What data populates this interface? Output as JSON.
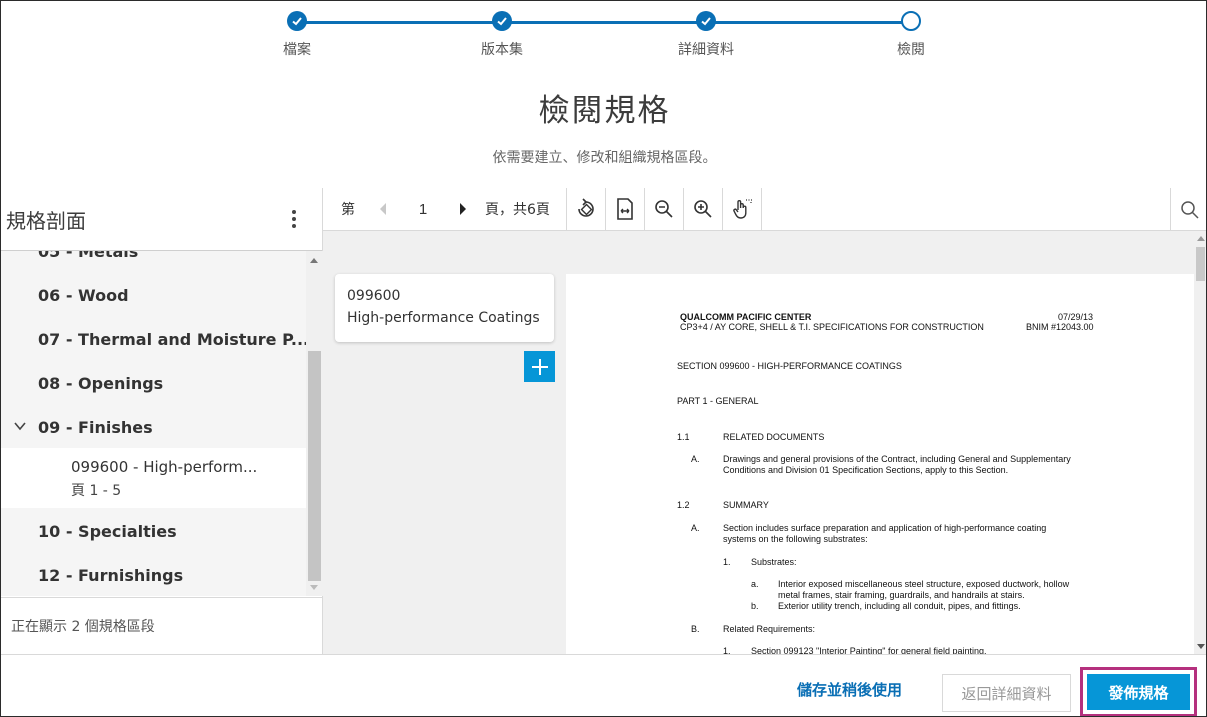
{
  "stepper": {
    "steps": [
      {
        "label": "檔案",
        "state": "done"
      },
      {
        "label": "版本集",
        "state": "done"
      },
      {
        "label": "詳細資料",
        "state": "done"
      },
      {
        "label": "檢閱",
        "state": "current"
      }
    ]
  },
  "page": {
    "title": "檢閱規格",
    "subtitle": "依需要建立、修改和組織規格區段。"
  },
  "sidebar": {
    "title": "規格剖面",
    "items": [
      {
        "label": "05 - Metals",
        "expanded": false
      },
      {
        "label": "06 - Wood",
        "expanded": false
      },
      {
        "label": "07 - Thermal and Moisture P...",
        "expanded": false
      },
      {
        "label": "08 - Openings",
        "expanded": false
      },
      {
        "label": "09 - Finishes",
        "expanded": true
      },
      {
        "label": "10 - Specialties",
        "expanded": false
      },
      {
        "label": "12 - Furnishings",
        "expanded": false
      }
    ],
    "selected_sub": {
      "title": "099600 - High-perform...",
      "pages": "頁 1 - 5"
    },
    "footer_text": "正在顯示 2 個規格區段"
  },
  "toolbar": {
    "page_prefix": "第",
    "page_value": "1",
    "page_suffix": "頁，共6頁"
  },
  "section_card": {
    "code": "099600",
    "name": "High-performance Coatings"
  },
  "document": {
    "header_left_1": "QUALCOMM PACIFIC CENTER",
    "header_left_2": "CP3+4 / AY CORE, SHELL & T.I. SPECIFICATIONS FOR CONSTRUCTION",
    "header_right_1": "07/29/13",
    "header_right_2": "BNIM #12043.00",
    "section_title": "SECTION 099600 - HIGH-PERFORMANCE COATINGS",
    "part": "PART 1 - GENERAL",
    "n11": "1.1",
    "n11_title": "RELATED DOCUMENTS",
    "a1": "A.",
    "a1_l1": "Drawings and general provisions of the Contract, including General and Supplementary",
    "a1_l2": "Conditions and Division 01 Specification Sections, apply to this Section.",
    "n12": "1.2",
    "n12_title": "SUMMARY",
    "a2": "A.",
    "a2_l1": "Section includes surface preparation and application of high-performance coating",
    "a2_l2": "systems on the following substrates:",
    "s1": "1.",
    "s1_t": "Substrates:",
    "ia": "a.",
    "ia_l1": "Interior exposed miscellaneous steel structure, exposed ductwork, hollow",
    "ia_l2": "metal frames, stair framing, guardrails, and handrails at stairs.",
    "ib": "b.",
    "ib_l1": "Exterior utility trench, including all conduit, pipes, and fittings.",
    "b": "B.",
    "b_t": "Related Requirements:",
    "r1": "1.",
    "r1_t": "Section 099123 \"Interior Painting\" for general field painting."
  },
  "footer": {
    "save_later": "儲存並稍後使用",
    "back": "返回詳細資料",
    "publish": "發佈規格"
  },
  "colors": {
    "accent": "#0a6fb5",
    "primary_button": "#0696d7",
    "highlight_border": "#b5307e"
  }
}
